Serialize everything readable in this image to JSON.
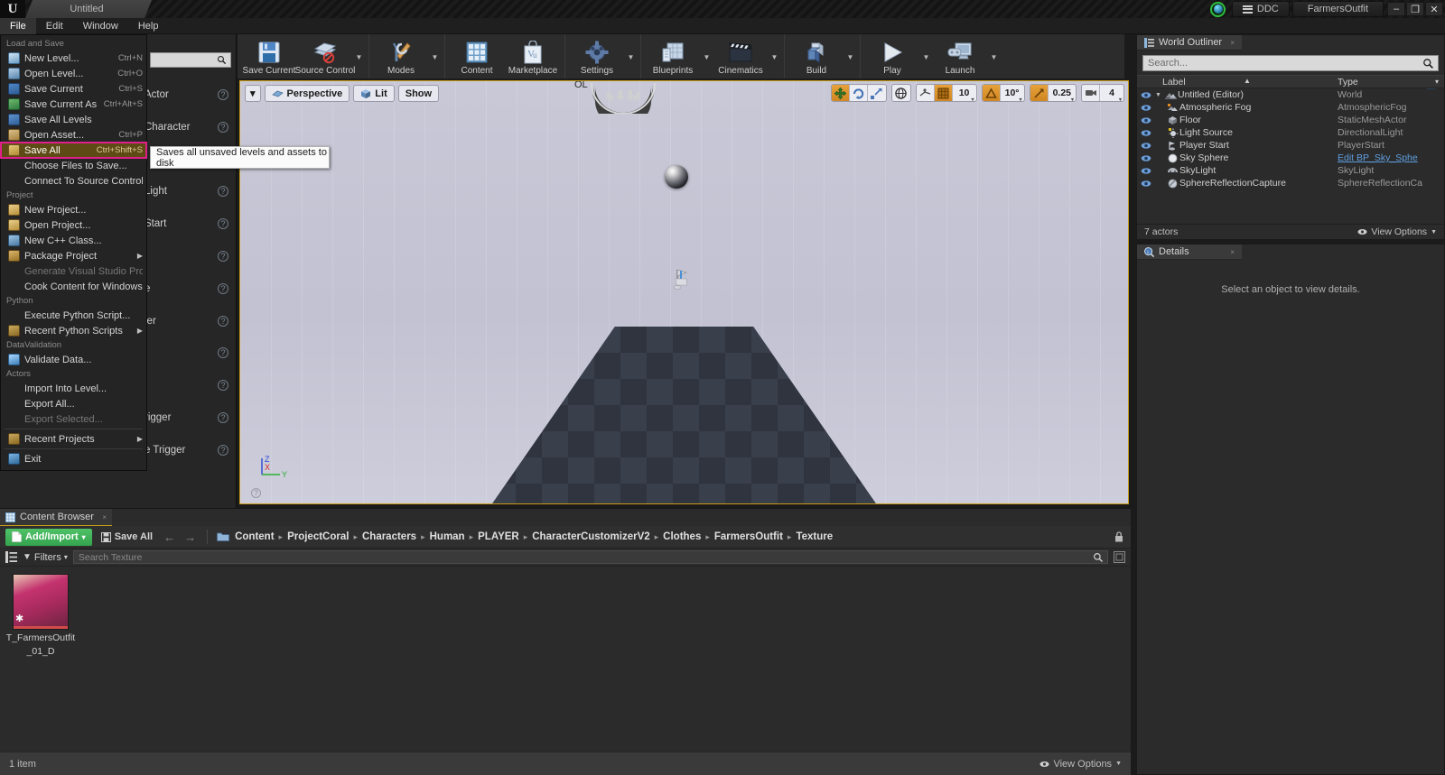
{
  "titlebar": {
    "logo": "unreal-logo",
    "project_tab": "Untitled",
    "ddc_label": "DDC",
    "project_name": "FarmersOutfit",
    "minimize": "–",
    "maximize": "❐",
    "close": "✕"
  },
  "menubar": {
    "items": [
      {
        "label": "File",
        "active": true
      },
      {
        "label": "Edit",
        "active": false
      },
      {
        "label": "Window",
        "active": false
      },
      {
        "label": "Help",
        "active": false
      }
    ]
  },
  "file_menu": {
    "sections": [
      {
        "header": "Load and Save",
        "items": [
          {
            "label": "New Level...",
            "shortcut": "Ctrl+N",
            "icon": "new-level-icon",
            "icon_class": "ic-doc",
            "submenu": false,
            "disabled": false,
            "selected": false
          },
          {
            "label": "Open Level...",
            "shortcut": "Ctrl+O",
            "icon": "open-level-icon",
            "icon_class": "ic-open",
            "submenu": false,
            "disabled": false,
            "selected": false
          },
          {
            "label": "Save Current",
            "shortcut": "Ctrl+S",
            "icon": "save-icon",
            "icon_class": "ic-save",
            "submenu": false,
            "disabled": false,
            "selected": false
          },
          {
            "label": "Save Current As...",
            "shortcut": "Ctrl+Alt+S",
            "icon": "save-as-icon",
            "icon_class": "ic-saveas",
            "submenu": false,
            "disabled": false,
            "selected": false
          },
          {
            "label": "Save All Levels",
            "shortcut": "",
            "icon": "save-all-levels-icon",
            "icon_class": "ic-savelv",
            "submenu": false,
            "disabled": false,
            "selected": false
          },
          {
            "label": "Open Asset...",
            "shortcut": "Ctrl+P",
            "icon": "open-asset-icon",
            "icon_class": "ic-asset",
            "submenu": false,
            "disabled": false,
            "selected": false
          },
          {
            "label": "Save All",
            "shortcut": "Ctrl+Shift+S",
            "icon": "save-all-icon",
            "icon_class": "ic-saveall",
            "submenu": false,
            "disabled": false,
            "selected": true
          },
          {
            "label": "Choose Files to Save...",
            "shortcut": "",
            "icon": "none",
            "icon_class": "none",
            "submenu": false,
            "disabled": false,
            "selected": false
          },
          {
            "label": "Connect To Source Control...",
            "shortcut": "",
            "icon": "none",
            "icon_class": "none",
            "submenu": false,
            "disabled": false,
            "selected": false
          }
        ]
      },
      {
        "header": "Project",
        "items": [
          {
            "label": "New Project...",
            "shortcut": "",
            "icon": "new-project-icon",
            "icon_class": "ic-proj",
            "submenu": false,
            "disabled": false,
            "selected": false
          },
          {
            "label": "Open Project...",
            "shortcut": "",
            "icon": "open-project-icon",
            "icon_class": "ic-proj",
            "submenu": false,
            "disabled": false,
            "selected": false
          },
          {
            "label": "New C++ Class...",
            "shortcut": "",
            "icon": "new-cpp-class-icon",
            "icon_class": "ic-cpp",
            "submenu": false,
            "disabled": false,
            "selected": false
          },
          {
            "label": "Package Project",
            "shortcut": "",
            "icon": "package-icon",
            "icon_class": "ic-pkg",
            "submenu": true,
            "disabled": false,
            "selected": false
          },
          {
            "label": "Generate Visual Studio Project",
            "shortcut": "",
            "icon": "none",
            "icon_class": "none",
            "submenu": false,
            "disabled": true,
            "selected": false
          },
          {
            "label": "Cook Content for Windows",
            "shortcut": "",
            "icon": "none",
            "icon_class": "none",
            "submenu": false,
            "disabled": false,
            "selected": false
          }
        ]
      },
      {
        "header": "Python",
        "items": [
          {
            "label": "Execute Python Script...",
            "shortcut": "",
            "icon": "none",
            "icon_class": "none",
            "submenu": false,
            "disabled": false,
            "selected": false
          },
          {
            "label": "Recent Python Scripts",
            "shortcut": "",
            "icon": "recent-scripts-icon",
            "icon_class": "ic-recent",
            "submenu": true,
            "disabled": false,
            "selected": false
          }
        ]
      },
      {
        "header": "DataValidation",
        "items": [
          {
            "label": "Validate Data...",
            "shortcut": "",
            "icon": "validate-icon",
            "icon_class": "ic-validate",
            "submenu": false,
            "disabled": false,
            "selected": false
          }
        ]
      },
      {
        "header": "Actors",
        "items": [
          {
            "label": "Import Into Level...",
            "shortcut": "",
            "icon": "none",
            "icon_class": "none",
            "submenu": false,
            "disabled": false,
            "selected": false
          },
          {
            "label": "Export All...",
            "shortcut": "",
            "icon": "none",
            "icon_class": "none",
            "submenu": false,
            "disabled": false,
            "selected": false
          },
          {
            "label": "Export Selected...",
            "shortcut": "",
            "icon": "none",
            "icon_class": "none",
            "submenu": false,
            "disabled": true,
            "selected": false
          }
        ]
      },
      {
        "header": "",
        "items": [
          {
            "label": "Recent Projects",
            "shortcut": "",
            "icon": "recent-projects-icon",
            "icon_class": "ic-recent",
            "submenu": true,
            "disabled": false,
            "selected": false
          }
        ]
      },
      {
        "header": "",
        "items": [
          {
            "label": "Exit",
            "shortcut": "",
            "icon": "exit-icon",
            "icon_class": "ic-exit",
            "submenu": false,
            "disabled": false,
            "selected": false
          }
        ]
      }
    ]
  },
  "tooltip": {
    "text": "Saves all unsaved levels and assets to disk"
  },
  "modes_panel": {
    "search_placeholder": "",
    "rows": [
      {
        "label": "Actor",
        "help": "?"
      },
      {
        "label": "Character",
        "help": "?"
      },
      {
        "label": "",
        "help": "?"
      },
      {
        "label": "Light",
        "help": "?"
      },
      {
        "label": "Start",
        "help": "?"
      },
      {
        "label": "",
        "help": "?"
      },
      {
        "label": "e",
        "help": "?"
      },
      {
        "label": "ler",
        "help": "?"
      },
      {
        "label": "",
        "help": "?"
      },
      {
        "label": "",
        "help": "?"
      },
      {
        "label": "rigger",
        "help": "?"
      },
      {
        "label": "e Trigger",
        "help": "?"
      }
    ]
  },
  "main_toolbar": {
    "groups": [
      {
        "items": [
          {
            "label": "Save Current",
            "icon": "floppy-disk-icon",
            "caret": false
          },
          {
            "label": "Source Control",
            "icon": "source-control-icon",
            "caret": true
          }
        ]
      },
      {
        "items": [
          {
            "label": "Modes",
            "icon": "wrench-screwdriver-icon",
            "caret": true
          }
        ]
      },
      {
        "items": [
          {
            "label": "Content",
            "icon": "content-grid-icon",
            "caret": false
          },
          {
            "label": "Marketplace",
            "icon": "shopping-bag-icon",
            "caret": false
          }
        ]
      },
      {
        "items": [
          {
            "label": "Settings",
            "icon": "gear-icon",
            "caret": true
          }
        ]
      },
      {
        "items": [
          {
            "label": "Blueprints",
            "icon": "blueprint-icon",
            "caret": true
          },
          {
            "label": "Cinematics",
            "icon": "clapboard-icon",
            "caret": true
          }
        ]
      },
      {
        "items": [
          {
            "label": "Build",
            "icon": "build-blocks-icon",
            "caret": true
          }
        ]
      },
      {
        "items": [
          {
            "label": "Play",
            "icon": "play-triangle-icon",
            "caret": true
          },
          {
            "label": "Launch",
            "icon": "launch-device-icon",
            "caret": true
          }
        ]
      }
    ]
  },
  "viewport": {
    "dropdown_caret": "▾",
    "perspective_label": "Perspective",
    "lit_label": "Lit",
    "show_label": "Show",
    "grid_snap_value": "10",
    "angle_snap_value": "10°",
    "scale_snap_value": "0.25",
    "camera_speed_value": "4",
    "axis_z": "Z",
    "axis_x": "X",
    "axis_y": "Y",
    "overlay_text": "OL"
  },
  "outliner": {
    "tab_label": "World Outliner",
    "tab_close": "×",
    "search_placeholder": "Search...",
    "columns": {
      "label": "Label",
      "type": "Type"
    },
    "sort_asc": "▲",
    "sort_desc": "▾",
    "rows": [
      {
        "label": "Untitled (Editor)",
        "type": "World",
        "icon": "world-icon",
        "indent": 0,
        "expander": "▾",
        "link": false
      },
      {
        "label": "Atmospheric Fog",
        "type": "AtmosphericFog",
        "icon": "fog-icon",
        "indent": 1,
        "expander": "",
        "link": false
      },
      {
        "label": "Floor",
        "type": "StaticMeshActor",
        "icon": "mesh-icon",
        "indent": 1,
        "expander": "",
        "link": false
      },
      {
        "label": "Light Source",
        "type": "DirectionalLight",
        "icon": "sun-icon",
        "indent": 1,
        "expander": "",
        "link": false
      },
      {
        "label": "Player Start",
        "type": "PlayerStart",
        "icon": "playerstart-icon",
        "indent": 1,
        "expander": "",
        "link": false
      },
      {
        "label": "Sky Sphere",
        "type": "Edit BP_Sky_Sphe",
        "icon": "sphere-icon",
        "indent": 1,
        "expander": "",
        "link": true
      },
      {
        "label": "SkyLight",
        "type": "SkyLight",
        "icon": "skylight-icon",
        "indent": 1,
        "expander": "",
        "link": false
      },
      {
        "label": "SphereReflectionCapture",
        "type": "SphereReflectionCa",
        "icon": "reflection-icon",
        "indent": 1,
        "expander": "",
        "link": false
      }
    ],
    "footer_count": "7 actors",
    "view_options": "View Options"
  },
  "details": {
    "tab_label": "Details",
    "tab_close": "×",
    "empty_message": "Select an object to view details."
  },
  "content_browser": {
    "tab_label": "Content Browser",
    "tab_close": "×",
    "add_import_label": "Add/Import",
    "add_import_caret": "▾",
    "save_all_label": "Save All",
    "back_arrow": "←",
    "forward_arrow": "→",
    "breadcrumbs": [
      "Content",
      "ProjectCoral",
      "Characters",
      "Human",
      "PLAYER",
      "CharacterCustomizerV2",
      "Clothes",
      "FarmersOutfit",
      "Texture"
    ],
    "crumb_separator": "▸",
    "filters_label": "Filters",
    "filters_caret": "▾",
    "search_placeholder": "Search Texture",
    "assets": [
      {
        "name_line1": "T_FarmersOutfit",
        "name_line2": "_01_D",
        "dirty_marker": "✱"
      }
    ],
    "footer_count": "1 item",
    "view_options": "View Options"
  },
  "colors": {
    "accent_orange": "#c79a16",
    "highlight_menu": "#5d4a14",
    "highlight_outline": "#e01f8b",
    "green_button": "#34a44e",
    "link_blue": "#5f9fe0"
  }
}
